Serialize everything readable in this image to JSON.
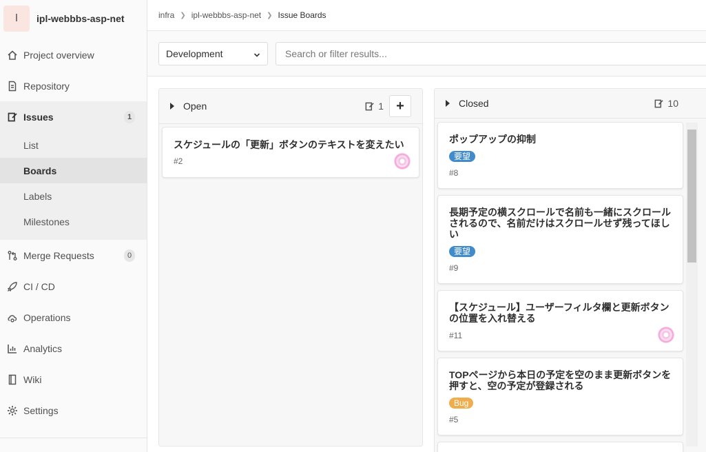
{
  "project": {
    "initial": "I",
    "name": "ipl-webbbs-asp-net"
  },
  "sidebar": {
    "items": [
      {
        "label": "Project overview",
        "icon": "home-icon"
      },
      {
        "label": "Repository",
        "icon": "document-icon"
      },
      {
        "label": "Issues",
        "icon": "issues-icon",
        "badge": "1"
      },
      {
        "label": "Merge Requests",
        "icon": "merge-request-icon",
        "badge": "0"
      },
      {
        "label": "CI / CD",
        "icon": "rocket-icon"
      },
      {
        "label": "Operations",
        "icon": "cloud-gear-icon"
      },
      {
        "label": "Analytics",
        "icon": "chart-icon"
      },
      {
        "label": "Wiki",
        "icon": "book-icon"
      },
      {
        "label": "Settings",
        "icon": "gear-icon"
      }
    ],
    "issues_sub": [
      "List",
      "Boards",
      "Labels",
      "Milestones"
    ]
  },
  "breadcrumb": {
    "group": "infra",
    "project": "ipl-webbbs-asp-net",
    "current": "Issue Boards"
  },
  "filter": {
    "board": "Development",
    "search_placeholder": "Search or filter results..."
  },
  "lists": {
    "open": {
      "title": "Open",
      "count": "1",
      "cards": [
        {
          "title": "スケジュールの「更新」ボタンのテキストを変えたい",
          "number": "#2"
        }
      ]
    },
    "closed": {
      "title": "Closed",
      "count": "10",
      "cards": [
        {
          "title": "ポップアップの抑制",
          "label": "要望",
          "number": "#8"
        },
        {
          "title": "長期予定の横スクロールで名前も一緒にスクロールされるので、名前だけはスクロールせず残ってほしい",
          "label": "要望",
          "number": "#9"
        },
        {
          "title": "【スケジュール】ユーザーフィルタ欄と更新ボタンの位置を入れ替える",
          "number": "#11"
        },
        {
          "title": "TOPページから本日の予定を空のまま更新ボタンを押すと、空の予定が登録される",
          "label": "Bug",
          "number": "#5"
        }
      ]
    }
  },
  "colors": {
    "label_request": "#428bca",
    "label_bug": "#f0ad4e"
  }
}
